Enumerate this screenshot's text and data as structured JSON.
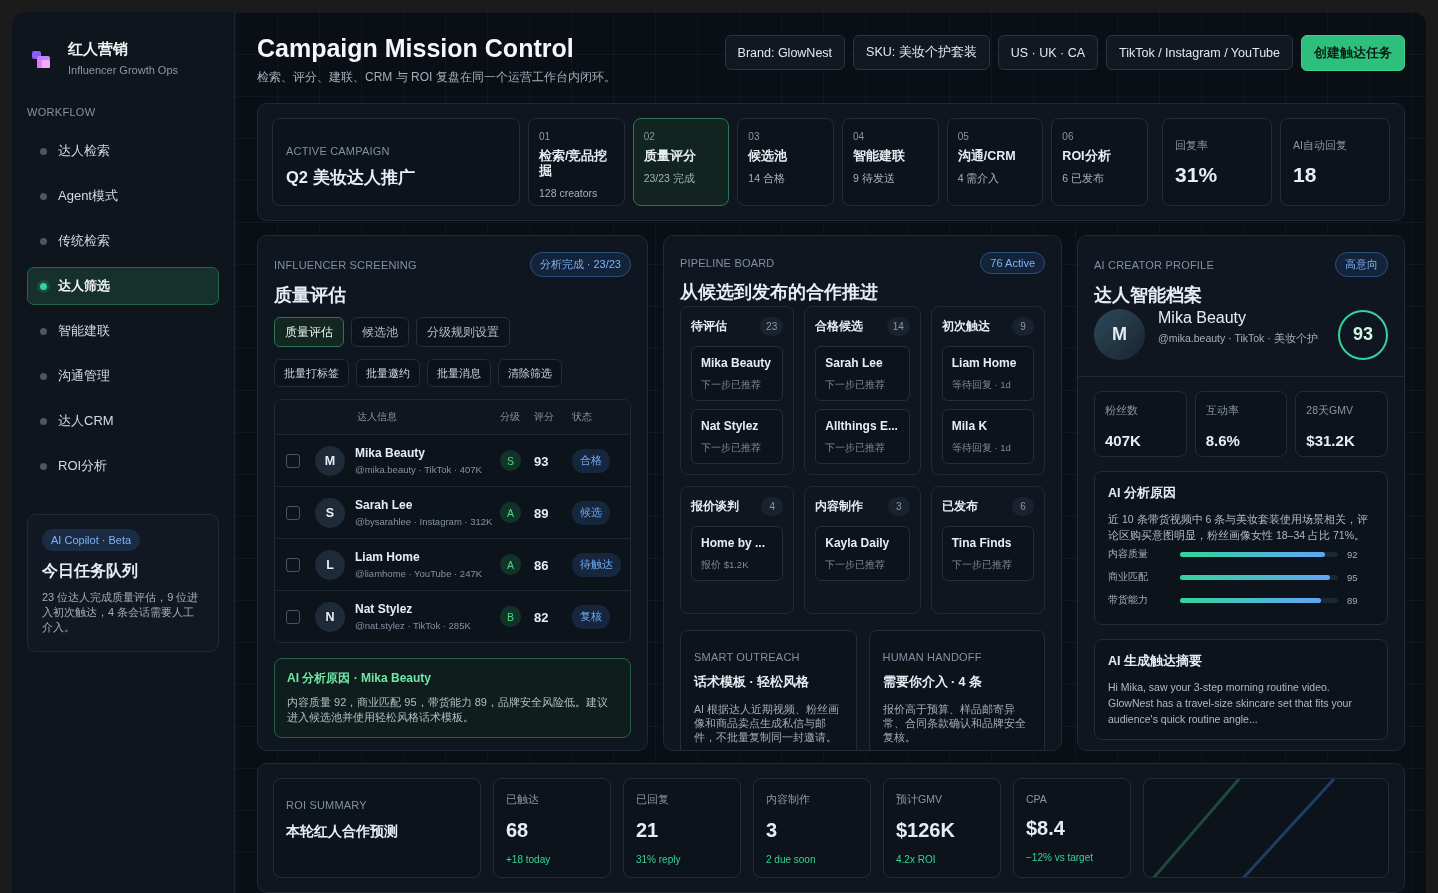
{
  "sidebar": {
    "brand": {
      "title": "红人营销",
      "subtitle": "Influencer Growth Ops"
    },
    "section_label": "WORKFLOW",
    "items": [
      {
        "label": "达人检索",
        "selected": false
      },
      {
        "label": "Agent模式",
        "selected": false
      },
      {
        "label": "传统检索",
        "selected": false
      },
      {
        "label": "达人筛选",
        "selected": true
      },
      {
        "label": "智能建联",
        "selected": false
      },
      {
        "label": "沟通管理",
        "selected": false
      },
      {
        "label": "达人CRM",
        "selected": false
      },
      {
        "label": "ROI分析",
        "selected": false
      }
    ],
    "copilot": {
      "badge": "AI Copilot · Beta",
      "title": "今日任务队列",
      "text": "23 位达人完成质量评估，9 位进入初次触达，4 条会话需要人工介入。"
    }
  },
  "header": {
    "title": "Campaign Mission Control",
    "subtitle": "检索、评分、建联、CRM 与 ROI 复盘在同一个运营工作台内闭环。",
    "filters": [
      "Brand: GlowNest",
      "SKU: 美妆个护套装",
      "US · UK · CA",
      "TikTok / Instagram / YouTube"
    ],
    "action": "创建触达任务"
  },
  "stages": {
    "campaign": {
      "label": "ACTIVE CAMPAIGN",
      "name": "Q2 美妆达人推广"
    },
    "steps": [
      {
        "number": "01",
        "name": "检索/竞品挖掘",
        "detail": "128 creators",
        "selected": false
      },
      {
        "number": "02",
        "name": "质量评分",
        "detail": "23/23 完成",
        "selected": true
      },
      {
        "number": "03",
        "name": "候选池",
        "detail": "14 合格",
        "selected": false
      },
      {
        "number": "04",
        "name": "智能建联",
        "detail": "9 待发送",
        "selected": false
      },
      {
        "number": "05",
        "name": "沟通/CRM",
        "detail": "4 需介入",
        "selected": false
      },
      {
        "number": "06",
        "name": "ROI分析",
        "detail": "6 已发布",
        "selected": false
      }
    ],
    "metrics": [
      {
        "label": "回复率",
        "value": "31%"
      },
      {
        "label": "AI自动回复",
        "value": "18"
      }
    ]
  },
  "screening": {
    "eyebrow": "INFLUENCER SCREENING",
    "badge": "分析完成 · 23/23",
    "title": "质量评估",
    "tabs": [
      {
        "label": "质量评估",
        "selected": true
      },
      {
        "label": "候选池",
        "selected": false
      },
      {
        "label": "分级规则设置",
        "selected": false
      }
    ],
    "actions": [
      "批量打标签",
      "批量邀约",
      "批量消息",
      "清除筛选"
    ],
    "table": {
      "columns": [
        "达人信息",
        "分级",
        "评分",
        "状态"
      ],
      "rows": [
        {
          "checked": false,
          "avatar": "M",
          "name": "Mika Beauty",
          "meta": "@mika.beauty · TikTok · 407K",
          "grade": "S",
          "score": "93",
          "status": "合格"
        },
        {
          "checked": false,
          "avatar": "S",
          "name": "Sarah Lee",
          "meta": "@bysarahlee · Instagram · 312K",
          "grade": "A",
          "score": "89",
          "status": "候选"
        },
        {
          "checked": false,
          "avatar": "L",
          "name": "Liam Home",
          "meta": "@liamhome · YouTube · 247K",
          "grade": "A",
          "score": "86",
          "status": "待触达"
        },
        {
          "checked": false,
          "avatar": "N",
          "name": "Nat Stylez",
          "meta": "@nat.stylez · TikTok · 285K",
          "grade": "B",
          "score": "82",
          "status": "复核"
        }
      ]
    },
    "reason": {
      "title": "AI 分析原因 · Mika Beauty",
      "text": "内容质量 92，商业匹配 95，带货能力 89，品牌安全风险低。建议进入候选池并使用轻松风格话术模板。"
    }
  },
  "pipeline": {
    "eyebrow": "PIPELINE BOARD",
    "badge": "76 Active",
    "title": "从候选到发布的合作推进",
    "columns": [
      {
        "name": "待评估",
        "count": "23",
        "cards": [
          {
            "name": "Mika Beauty",
            "note": "下一步已推荐"
          },
          {
            "name": "Nat Stylez",
            "note": "下一步已推荐"
          }
        ]
      },
      {
        "name": "合格候选",
        "count": "14",
        "cards": [
          {
            "name": "Sarah Lee",
            "note": "下一步已推荐"
          },
          {
            "name": "Allthings E...",
            "note": "下一步已推荐"
          }
        ]
      },
      {
        "name": "初次触达",
        "count": "9",
        "cards": [
          {
            "name": "Liam Home",
            "note": "等待回复 · 1d"
          },
          {
            "name": "Mila K",
            "note": "等待回复 · 1d"
          }
        ]
      },
      {
        "name": "报价谈判",
        "count": "4",
        "cards": [
          {
            "name": "Home by ...",
            "note": "报价 $1.2K"
          }
        ]
      },
      {
        "name": "内容制作",
        "count": "3",
        "cards": [
          {
            "name": "Kayla Daily",
            "note": "下一步已推荐"
          }
        ]
      },
      {
        "name": "已发布",
        "count": "6",
        "cards": [
          {
            "name": "Tina Finds",
            "note": "下一步已推荐"
          }
        ]
      }
    ],
    "notes": [
      {
        "eyebrow": "SMART OUTREACH",
        "title": "话术模板 · 轻松风格",
        "text": "AI 根据达人近期视频、粉丝画像和商品卖点生成私信与邮件，不批量复制同一封邀请。"
      },
      {
        "eyebrow": "HUMAN HANDOFF",
        "title": "需要你介入 · 4 条",
        "text": "报价高于预算、样品邮寄异常、合同条款确认和品牌安全复核。"
      }
    ]
  },
  "profile": {
    "eyebrow": "AI CREATOR PROFILE",
    "badge": "高意向",
    "title": "达人智能档案",
    "creator": {
      "avatar": "M",
      "name": "Mika Beauty",
      "meta": "@mika.beauty · TikTok · 美妆个护",
      "score": "93"
    },
    "stats": [
      {
        "label": "粉丝数",
        "value": "407K"
      },
      {
        "label": "互动率",
        "value": "8.6%"
      },
      {
        "label": "28天GMV",
        "value": "$31.2K"
      }
    ],
    "reason": {
      "title": "AI 分析原因",
      "text": "近 10 条带货视频中 6 条与美妆套装使用场景相关，评论区购买意图明显，粉丝画像女性 18–34 占比 71%。",
      "bars": [
        {
          "label": "内容质量",
          "level": 0.92,
          "value": "92"
        },
        {
          "label": "商业匹配",
          "level": 0.95,
          "value": "95"
        },
        {
          "label": "带货能力",
          "level": 0.89,
          "value": "89"
        }
      ]
    },
    "summary": {
      "title": "AI 生成触达摘要",
      "text": "Hi Mika, saw your 3-step morning routine video. GlowNest has a travel-size skincare set that fits your audience's quick routine angle..."
    }
  },
  "roi": {
    "eyebrow": "ROI SUMMARY",
    "title": "本轮红人合作预测",
    "metrics": [
      {
        "label": "已触达",
        "value": "68",
        "delta": "+18 today"
      },
      {
        "label": "已回复",
        "value": "21",
        "delta": "31% reply"
      },
      {
        "label": "内容制作",
        "value": "3",
        "delta": "2 due soon"
      },
      {
        "label": "预计GMV",
        "value": "$126K",
        "delta": "4.2x ROI"
      },
      {
        "label": "CPA",
        "value": "$8.4",
        "delta": "−12% vs target"
      }
    ]
  }
}
